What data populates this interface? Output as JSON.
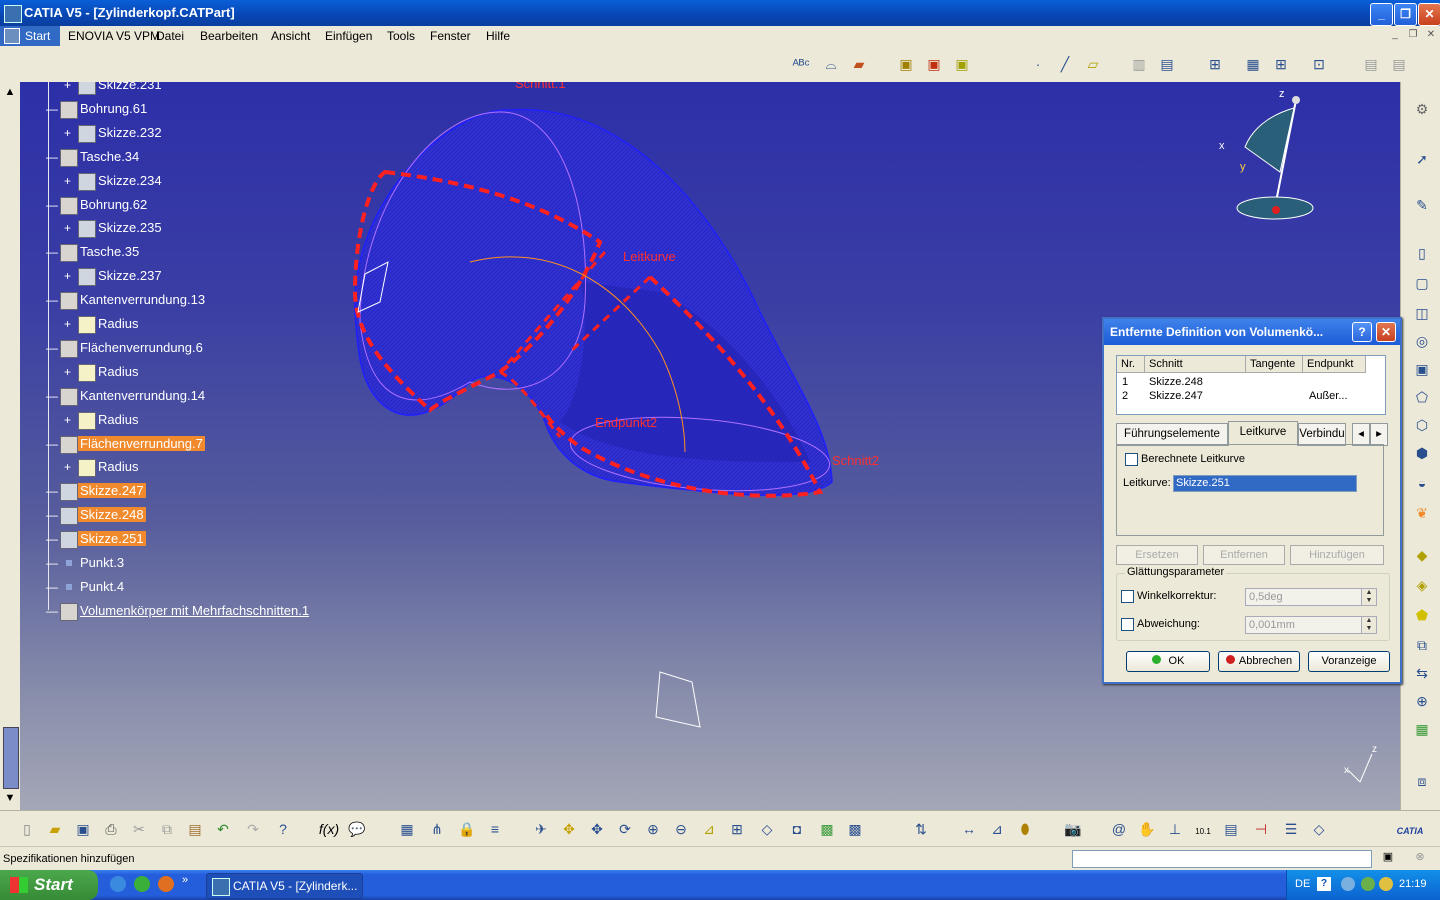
{
  "window": {
    "title": "CATIA V5 - [Zylinderkopf.CATPart]"
  },
  "menu": {
    "start": "Start",
    "items": [
      "ENOVIA V5 VPM",
      "Datei",
      "Bearbeiten",
      "Ansicht",
      "Einfügen",
      "Tools",
      "Fenster",
      "Hilfe"
    ]
  },
  "tree": [
    {
      "label": "Skizze.231",
      "level": 2,
      "type": "sketch"
    },
    {
      "label": "Bohrung.61",
      "level": 1,
      "type": "feature"
    },
    {
      "label": "Skizze.232",
      "level": 2,
      "type": "sketch"
    },
    {
      "label": "Tasche.34",
      "level": 1,
      "type": "feature"
    },
    {
      "label": "Skizze.234",
      "level": 2,
      "type": "sketch"
    },
    {
      "label": "Bohrung.62",
      "level": 1,
      "type": "feature"
    },
    {
      "label": "Skizze.235",
      "level": 2,
      "type": "sketch"
    },
    {
      "label": "Tasche.35",
      "level": 1,
      "type": "feature"
    },
    {
      "label": "Skizze.237",
      "level": 2,
      "type": "sketch"
    },
    {
      "label": "Kantenverrundung.13",
      "level": 1,
      "type": "feature"
    },
    {
      "label": "Radius",
      "level": 2,
      "type": "radius"
    },
    {
      "label": "Flächenverrundung.6",
      "level": 1,
      "type": "feature"
    },
    {
      "label": "Radius",
      "level": 2,
      "type": "radius"
    },
    {
      "label": "Kantenverrundung.14",
      "level": 1,
      "type": "feature"
    },
    {
      "label": "Radius",
      "level": 2,
      "type": "radius"
    },
    {
      "label": "Flächenverrundung.7",
      "level": 1,
      "type": "feature",
      "highlight": true
    },
    {
      "label": "Radius",
      "level": 2,
      "type": "radius"
    },
    {
      "label": "Skizze.247",
      "level": 1,
      "type": "sketch",
      "highlight": true
    },
    {
      "label": "Skizze.248",
      "level": 1,
      "type": "sketch",
      "highlight": true
    },
    {
      "label": "Skizze.251",
      "level": 1,
      "type": "sketch",
      "highlight": true
    },
    {
      "label": "Punkt.3",
      "level": 1,
      "type": "point"
    },
    {
      "label": "Punkt.4",
      "level": 1,
      "type": "point"
    },
    {
      "label": "Volumenkörper mit Mehrfachschnitten.1",
      "level": 1,
      "type": "feature",
      "underline": true
    }
  ],
  "viewport_labels": {
    "schnitt1": "Schnitt.1",
    "leitkurve": "Leitkurve",
    "endpunkt": "Endpunkt2",
    "schnitt2": "Schnitt2"
  },
  "compass": {
    "z": "z",
    "x": "x",
    "y": "y"
  },
  "axis": {
    "z": "z",
    "x": "x"
  },
  "dialog": {
    "title": "Entfernte Definition von Volumenkö...",
    "help": "?",
    "columns": [
      "Nr.",
      "Schnitt",
      "Tangente",
      "Endpunkt"
    ],
    "rows": [
      {
        "nr": "1",
        "schnitt": "Skizze.248",
        "tangente": "",
        "endpunkt": ""
      },
      {
        "nr": "2",
        "schnitt": "Skizze.247",
        "tangente": "",
        "endpunkt": "Außer..."
      }
    ],
    "tabs": [
      "Führungselemente",
      "Leitkurve",
      "Verbindu"
    ],
    "active_tab": "Leitkurve",
    "computed_label": "Berechnete Leitkurve",
    "leitkurve_label": "Leitkurve:",
    "leitkurve_value": "Skizze.251",
    "buttons_disabled": [
      "Ersetzen",
      "Entfernen",
      "Hinzufügen"
    ],
    "group_title": "Glättungsparameter",
    "angle_label": "Winkelkorrektur:",
    "angle_value": "0,5deg",
    "dev_label": "Abweichung:",
    "dev_value": "0,001mm",
    "ok": "OK",
    "cancel": "Abbrechen",
    "preview": "Voranzeige"
  },
  "status": {
    "text": "Spezifikationen hinzufügen"
  },
  "taskbar": {
    "start": "Start",
    "app": "CATIA V5 - [Zylinderk...",
    "lang": "DE",
    "time": "21:19"
  }
}
